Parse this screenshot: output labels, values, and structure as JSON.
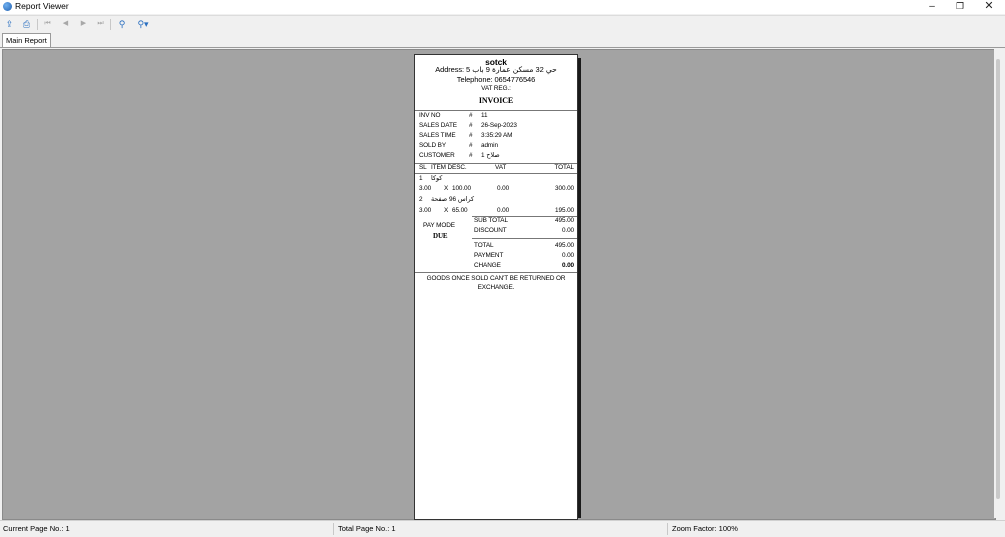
{
  "window": {
    "title": "Report Viewer",
    "min": "–",
    "max": "❐",
    "close": "✕"
  },
  "toolbar": {
    "export": "⇪",
    "print": "⎙",
    "first": "⏮",
    "prev": "◀",
    "next": "▶",
    "last": "⏭",
    "find": "⚲",
    "zoom": "⚲▾"
  },
  "tabs": {
    "main": "Main Report"
  },
  "receipt": {
    "store": "sotck",
    "address": "Address: حي 32 مسكن عمارة 9 باب 5",
    "telephone": "Telephone: 0654776546",
    "vat_reg": "VAT REG.:",
    "title": "INVOICE",
    "info": [
      {
        "label": "INV NO",
        "sep": "#",
        "value": "11"
      },
      {
        "label": "SALES DATE",
        "sep": "#",
        "value": "26-Sep-2023"
      },
      {
        "label": "SALES TIME",
        "sep": "#",
        "value": "3:35:29 AM"
      },
      {
        "label": "SOLD BY",
        "sep": "#",
        "value": "admin"
      },
      {
        "label": "CUSTOMER",
        "sep": "#",
        "value": "1     صلاح"
      }
    ],
    "columns": {
      "sl": "SL",
      "item": "ITEM DESC.",
      "vat": "VAT",
      "total": "TOTAL"
    },
    "items": [
      {
        "sl": "1",
        "name": "كوكا",
        "qty": "3.00",
        "x": "X",
        "price": "100.00",
        "vat": "0.00",
        "total": "300.00"
      },
      {
        "sl": "2",
        "name": "كراس 96 صفحة",
        "qty": "3.00",
        "x": "X",
        "price": "65.00",
        "vat": "0.00",
        "total": "195.00"
      }
    ],
    "paymode_label": "PAY MODE",
    "paymode_value": "DUE",
    "totals": [
      {
        "label": "SUB TOTAL",
        "value": "495.00"
      },
      {
        "label": "DISCOUNT",
        "value": "0.00"
      },
      {
        "label": "TOTAL",
        "value": "495.00"
      },
      {
        "label": "PAYMENT",
        "value": "0.00"
      },
      {
        "label": "CHANGE",
        "value": "0.00"
      }
    ],
    "footer": "GOODS ONCE SOLD CAN'T BE RETURNED OR EXCHANGE."
  },
  "status": {
    "current_page": "Current Page No.: 1",
    "total_page": "Total Page No.: 1",
    "zoom": "Zoom Factor: 100%"
  }
}
